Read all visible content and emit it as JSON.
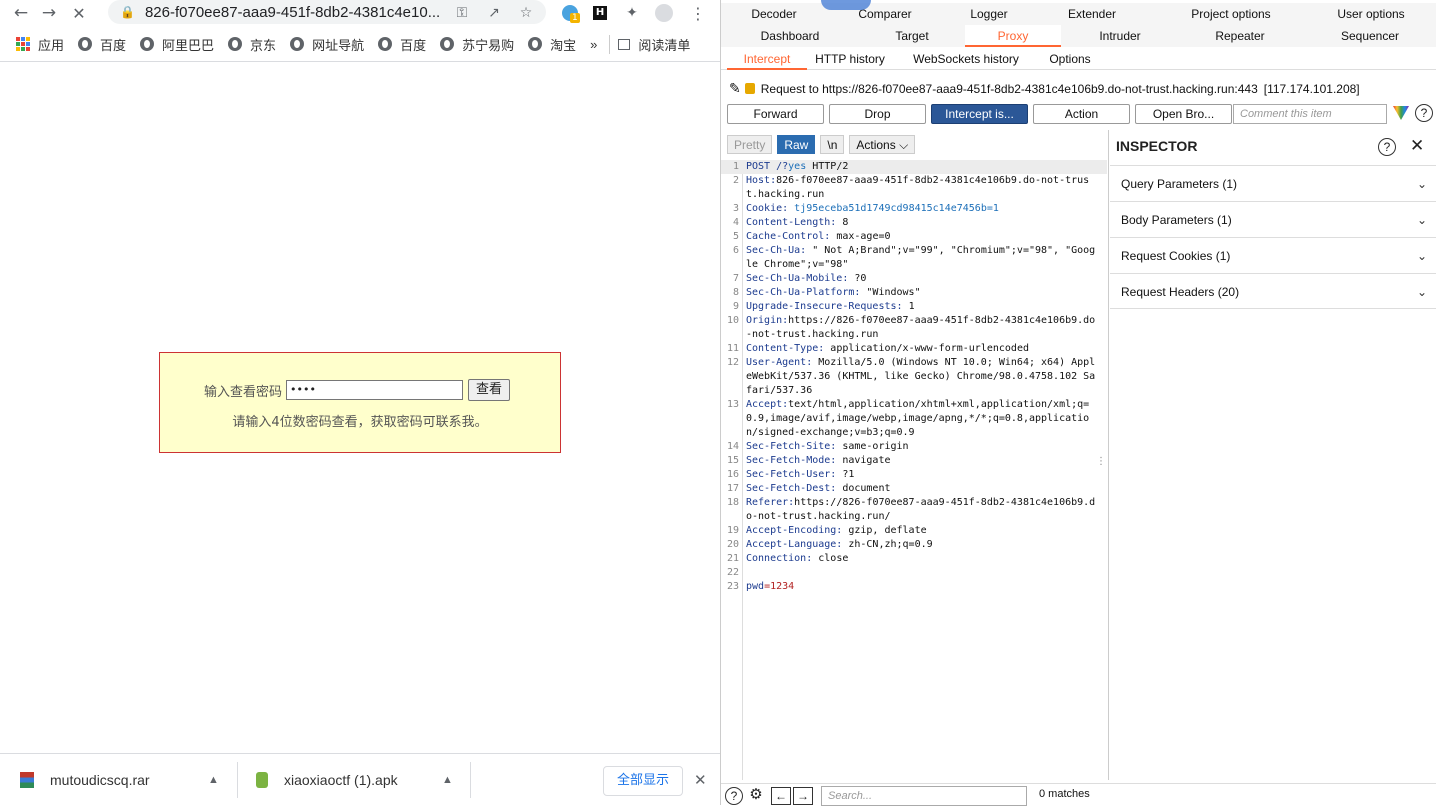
{
  "browser": {
    "url": "826-f070ee87-aaa9-451f-8db2-4381c4e10...",
    "bookmarks": [
      "应用",
      "百度",
      "阿里巴巴",
      "京东",
      "网址导航",
      "百度",
      "苏宁易购",
      "淘宝"
    ],
    "more": "»",
    "reading_list": "阅读清单",
    "ext_badge": "1",
    "page": {
      "label": "输入查看密码",
      "password_value": "••••",
      "button": "查看",
      "hint": "请输入4位数密码查看，获取密码可联系我。"
    },
    "downloads": [
      {
        "name": "mutoudicscq.rar"
      },
      {
        "name": "xiaoxiaoctf (1).apk"
      }
    ],
    "show_all": "全部显示"
  },
  "burp": {
    "top_tabs": [
      "Decoder",
      "Comparer",
      "Logger",
      "Extender",
      "Project options",
      "User options"
    ],
    "main_tabs": [
      "Dashboard",
      "Target",
      "Proxy",
      "Intruder",
      "Repeater",
      "Sequencer"
    ],
    "active_main_tab": "Proxy",
    "sub_tabs": [
      "Intercept",
      "HTTP history",
      "WebSockets history",
      "Options"
    ],
    "active_sub_tab": "Intercept",
    "request_to": "Request to https://826-f070ee87-aaa9-451f-8db2-4381c4e106b9.do-not-trust.hacking.run:443",
    "ip": "[117.174.101.208]",
    "buttons": {
      "forward": "Forward",
      "drop": "Drop",
      "intercept": "Intercept is...",
      "action": "Action",
      "open_browser": "Open Bro..."
    },
    "comment_placeholder": "Comment this item",
    "editor_tabs": {
      "pretty": "Pretty",
      "raw": "Raw",
      "newline": "\\n",
      "actions": "Actions"
    },
    "request_lines": [
      {
        "n": "1",
        "k": "POST /?",
        "q": "yes",
        "v": " HTTP/2"
      },
      {
        "n": "2",
        "k": "Host:",
        "v": "826-f070ee87-aaa9-451f-8db2-4381c4e106b9.do-not-trust.hacking.run"
      },
      {
        "n": "3",
        "k": "Cookie:",
        "v": " tj95eceba51d1749cd98415c14e7456b=1",
        "vc": "ql"
      },
      {
        "n": "4",
        "k": "Content-Length:",
        "v": " 8"
      },
      {
        "n": "5",
        "k": "Cache-Control:",
        "v": " max-age=0"
      },
      {
        "n": "6",
        "k": "Sec-Ch-Ua:",
        "v": " \" Not A;Brand\";v=\"99\", \"Chromium\";v=\"98\", \"Google Chrome\";v=\"98\""
      },
      {
        "n": "7",
        "k": "Sec-Ch-Ua-Mobile:",
        "v": " ?0"
      },
      {
        "n": "8",
        "k": "Sec-Ch-Ua-Platform:",
        "v": " \"Windows\""
      },
      {
        "n": "9",
        "k": "Upgrade-Insecure-Requests:",
        "v": " 1"
      },
      {
        "n": "10",
        "k": "Origin:",
        "v": "https://826-f070ee87-aaa9-451f-8db2-4381c4e106b9.do-not-trust.hacking.run"
      },
      {
        "n": "11",
        "k": "Content-Type:",
        "v": " application/x-www-form-urlencoded"
      },
      {
        "n": "12",
        "k": "User-Agent:",
        "v": " Mozilla/5.0 (Windows NT 10.0; Win64; x64) AppleWebKit/537.36 (KHTML, like Gecko) Chrome/98.0.4758.102 Safari/537.36"
      },
      {
        "n": "13",
        "k": "Accept:",
        "v": "text/html,application/xhtml+xml,application/xml;q=0.9,image/avif,image/webp,image/apng,*/*;q=0.8,application/signed-exchange;v=b3;q=0.9"
      },
      {
        "n": "14",
        "k": "Sec-Fetch-Site:",
        "v": " same-origin"
      },
      {
        "n": "15",
        "k": "Sec-Fetch-Mode:",
        "v": " navigate"
      },
      {
        "n": "16",
        "k": "Sec-Fetch-User:",
        "v": " ?1"
      },
      {
        "n": "17",
        "k": "Sec-Fetch-Dest:",
        "v": " document"
      },
      {
        "n": "18",
        "k": "Referer:",
        "v": "https://826-f070ee87-aaa9-451f-8db2-4381c4e106b9.do-not-trust.hacking.run/"
      },
      {
        "n": "19",
        "k": "Accept-Encoding:",
        "v": " gzip, deflate"
      },
      {
        "n": "20",
        "k": "Accept-Language:",
        "v": " zh-CN,zh;q=0.9"
      },
      {
        "n": "21",
        "k": "Connection:",
        "v": " close"
      },
      {
        "n": "22",
        "k": "",
        "v": ""
      },
      {
        "n": "23",
        "k": "pwd",
        "v": "=1234",
        "body": true
      }
    ],
    "inspector": {
      "title": "INSPECTOR",
      "sections": [
        "Query Parameters (1)",
        "Body Parameters (1)",
        "Request Cookies (1)",
        "Request Headers (20)"
      ]
    },
    "search_placeholder": "Search...",
    "matches": "0 matches",
    "accent": "#ff6633"
  }
}
